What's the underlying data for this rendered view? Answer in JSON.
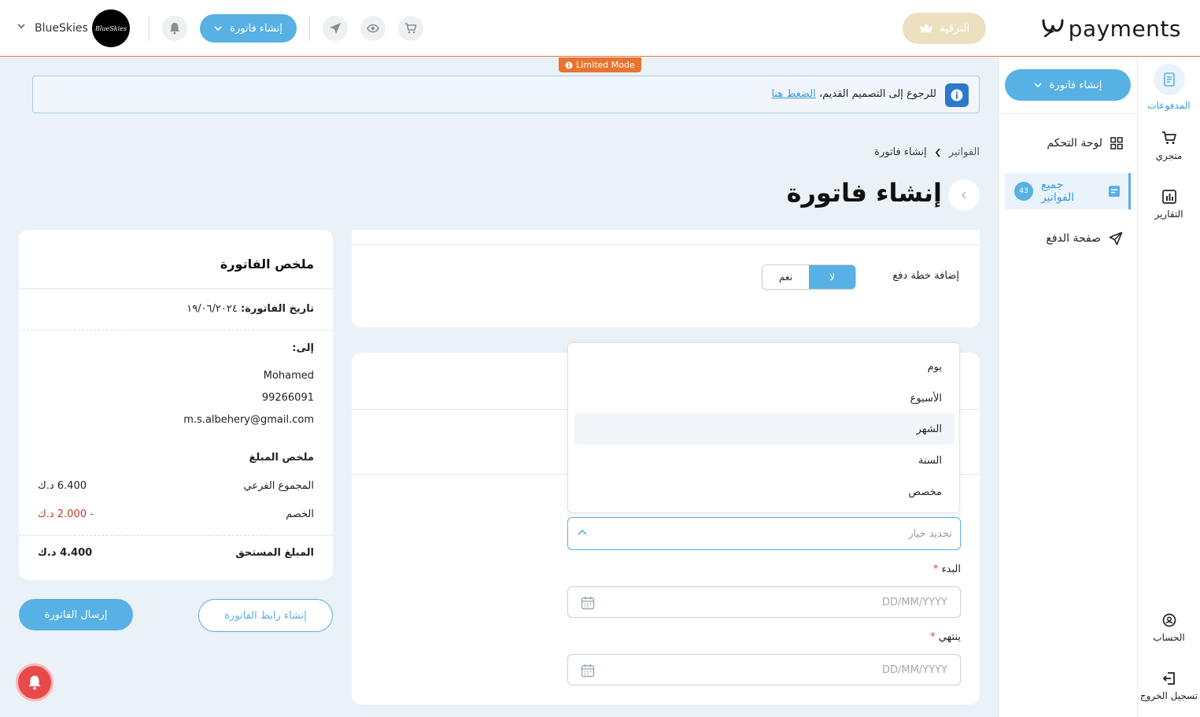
{
  "topbar": {
    "logo_text": "payments",
    "upgrade_label": "الترقية",
    "create_invoice_label": "إنشاء فاتورة",
    "brand_name": "BlueSkies",
    "brand_avatar_text": "BlueSkies"
  },
  "limited_mode": "Limited Mode",
  "notice": {
    "text": "للرجوع إلى التصميم القديم،",
    "link": "الضغط هنا"
  },
  "rail": {
    "payments": "المدفوعات",
    "store": "متجري",
    "reports": "التقارير",
    "account": "الحساب",
    "logout": "تسجيل الخروج"
  },
  "sidebar": {
    "create_label": "إنشاء فاتورة",
    "items": [
      {
        "label": "لوحة التحكم"
      },
      {
        "label": "جميع الفواتير",
        "badge": "43"
      },
      {
        "label": "صفحة الدفع"
      }
    ]
  },
  "breadcrumb": {
    "parent": "الفواتير",
    "current": "إنشاء فاتورة"
  },
  "page_title": "إنشاء فاتورة",
  "summary": {
    "title": "ملخص الفاتورة",
    "date_label": "تاريخ الفاتورة:",
    "date_value": "١٩/٠٦/٢٠٢٤",
    "to_label": "إلى:",
    "customer_name": "Mohamed",
    "customer_phone": "99266091",
    "customer_email": "m.s.albehery@gmail.com",
    "amount_title": "ملخص المبلغ",
    "subtotal_label": "المجموع الفرعي",
    "subtotal_value": "6.400 د.ك",
    "discount_label": "الخصم",
    "discount_value": "- 2.000 د.ك",
    "due_label": "المبلغ المستحق",
    "due_value": "4.400 د.ك"
  },
  "buttons": {
    "send_invoice": "إرسال الفاتورة",
    "create_link": "إنشاء رابط الفاتورة"
  },
  "payment_plan": {
    "label": "إضافة خطة دفع",
    "yes": "نعم",
    "no": "لا",
    "selected": "لا"
  },
  "period_dropdown": {
    "options": [
      "يوم",
      "الأسبوع",
      "الشهر",
      "السنة",
      "مخصص"
    ],
    "hovered": "الشهر",
    "placeholder": "تحديد خيار"
  },
  "start_field": {
    "label": "البدء",
    "required_mark": "*",
    "placeholder": "DD/MM/YYYY"
  },
  "end_field": {
    "label": "ينتهي",
    "required_mark": "*",
    "placeholder": "DD/MM/YYYY"
  },
  "colors": {
    "accent": "#57b1e4",
    "limited_badge": "#e8742f",
    "upgrade": "#ece0c0",
    "danger": "#c0392b",
    "notification_fab": "#e84a4a"
  },
  "icons": {
    "upgrade": "crown-icon",
    "notifications": "bell-icon",
    "send": "paper-plane-icon",
    "preview": "eye-icon",
    "cart": "cart-icon",
    "info": "info-icon",
    "calendar": "calendar-icon"
  }
}
